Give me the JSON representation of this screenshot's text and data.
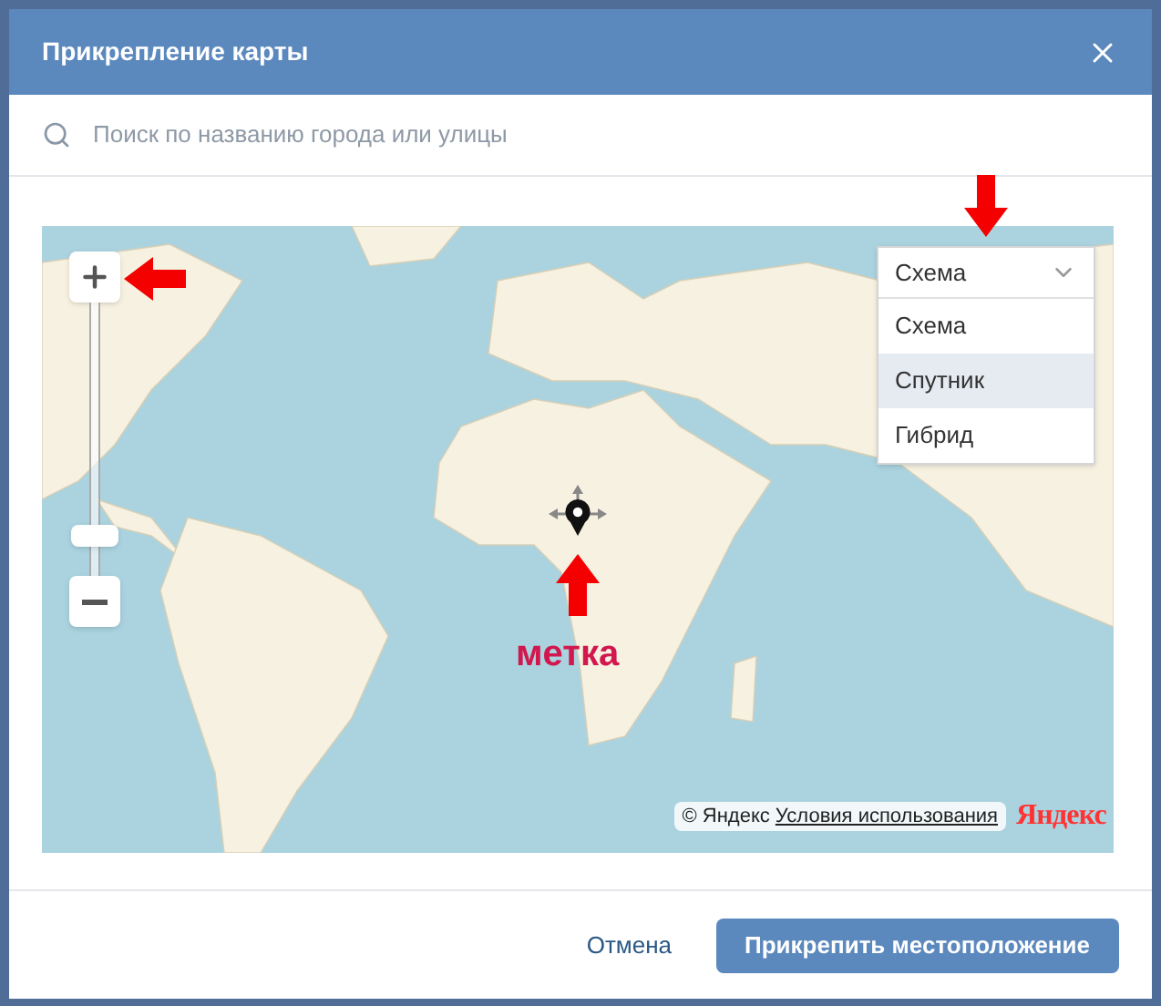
{
  "window": {
    "title": "Прикрепление карты"
  },
  "search": {
    "placeholder": "Поиск по названию города или улицы"
  },
  "map": {
    "zoom": {
      "level": 0.15
    },
    "layer_select": {
      "value": "Схема",
      "expanded": true,
      "options": [
        {
          "label": "Схема",
          "highlighted": false
        },
        {
          "label": "Спутник",
          "highlighted": true
        },
        {
          "label": "Гибрид",
          "highlighted": false
        }
      ]
    },
    "annotation": {
      "label": "метка"
    },
    "copyright": {
      "symbol": "©",
      "owner": "Яндекс",
      "terms_link": "Условия использования",
      "logo": "Яндекс"
    }
  },
  "buttons": [
    {
      "label": "Отмена",
      "kind": "secondary"
    },
    {
      "label": "Прикрепить местоположение",
      "kind": "primary"
    }
  ]
}
